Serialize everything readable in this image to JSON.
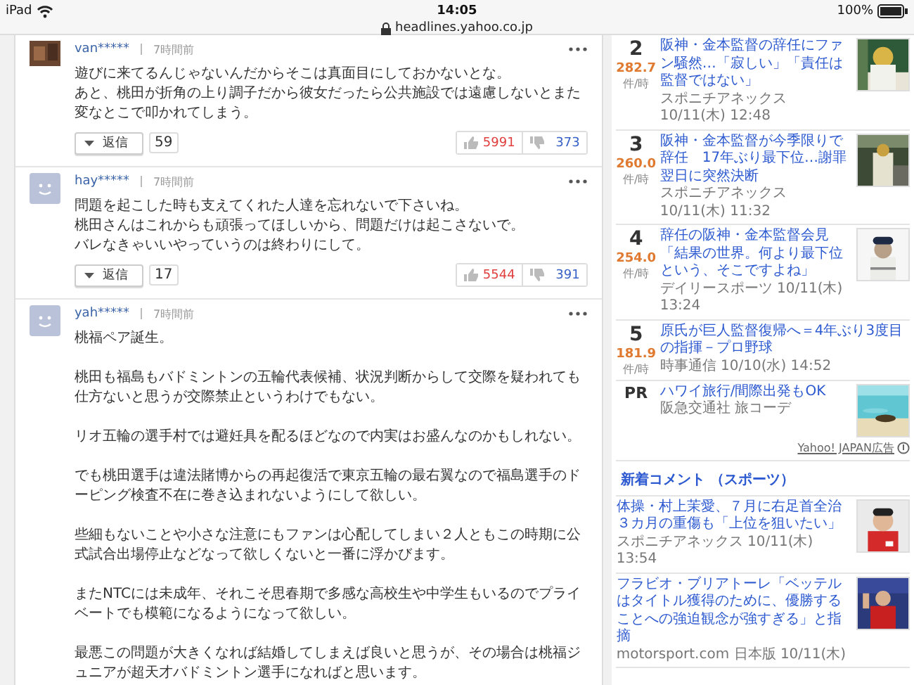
{
  "status_bar": {
    "device": "iPad",
    "time": "14:05",
    "url": "headlines.yahoo.co.jp",
    "battery": "100%"
  },
  "comments": [
    {
      "user": "van*****",
      "posted": "7時間前",
      "paragraphs": [
        [
          "遊びに来てるんじゃないんだからそこは真面目にしておかないとな。",
          "あと、桃田が折角の上り調子だから彼女だったら公共施設では遠慮しないとまた変なとこで叩かれてしまう。"
        ]
      ],
      "reply_label": "返信",
      "reply_count": "59",
      "likes": "5991",
      "dislikes": "373"
    },
    {
      "kind": "default",
      "user": "hay*****",
      "posted": "7時間前",
      "paragraphs": [
        [
          "問題を起こした時も支えてくれた人達を忘れないで下さいね。",
          "桃田さんはこれからも頑張ってほしいから、問題だけは起こさないで。",
          "バレなきゃいいやっていうのは終わりにして。"
        ]
      ],
      "reply_label": "返信",
      "reply_count": "17",
      "likes": "5544",
      "dislikes": "391"
    },
    {
      "kind": "default",
      "user": "yah*****",
      "posted": "7時間前",
      "paragraphs": [
        [
          "桃福ペア誕生。"
        ],
        [
          "桃田も福島もバドミントンの五輪代表候補、状況判断からして交際を疑われても仕方ないと思うが交際禁止というわけでもない。"
        ],
        [
          "リオ五輪の選手村では避妊具を配るほどなので内実はお盛んなのかもしれない。"
        ],
        [
          "でも桃田選手は違法賭博からの再起復活で東京五輪の最右翼なので福島選手のドーピング検査不在に巻き込まれないようにして欲しい。"
        ],
        [
          "些細もないことや小さな注意にもファンは心配してしまい２人ともこの時期に公式試合出場停止などなって欲しくないと一番に浮かびます。"
        ],
        [
          "またNTCには未成年、それこそ思春期で多感な高校生や中学生もいるのでプライベートでも模範になるようになって欲しい。"
        ],
        [
          "最悪この問題が大きくなれば結婚してしまえば良いと思うが、その場合は桃福ジュニアが超天才バドミントン選手になればと思います。"
        ]
      ]
    }
  ],
  "ranking": [
    {
      "rank": "2",
      "score": "282.7",
      "unit": "件/時",
      "title": "阪神・金本監督の辞任にファン騒然…「寂しい」「責任は監督ではない」",
      "meta": "スポニチアネックス 10/11(木) 12:48",
      "thumbnail": true
    },
    {
      "rank": "3",
      "score": "260.0",
      "unit": "件/時",
      "title": "阪神・金本監督が今季限りで辞任　17年ぶり最下位…謝罪翌日に突然決断",
      "meta": "スポニチアネックス 10/11(木) 11:32",
      "thumbnail": true
    },
    {
      "rank": "4",
      "score": "254.0",
      "unit": "件/時",
      "title": "辞任の阪神・金本監督会見「結果の世界。何より最下位という、そこですよね」",
      "meta": "デイリースポーツ 10/11(木) 13:24",
      "thumbnail": true
    },
    {
      "rank": "5",
      "score": "181.9",
      "unit": "件/時",
      "title": "原氏が巨人監督復帰へ＝4年ぶり3度目の指揮－プロ野球",
      "meta": "時事通信 10/10(水) 14:52",
      "thumbnail": false
    }
  ],
  "pr": {
    "label": "PR",
    "title": "ハワイ旅行/間際出発もOK",
    "sponsor": "阪急交通社 旅コーデ",
    "ad_label": "Yahoo! JAPAN広告"
  },
  "new_comments": {
    "heading": "新着コメント （スポーツ）",
    "items": [
      {
        "title": "体操・村上茉愛、７月に右足首全治３カ月の重傷も「上位を狙いたい」",
        "meta": "スポニチアネックス 10/11(木) 13:54"
      },
      {
        "title": "フラビオ・ブリアトーレ「ベッテルはタイトル獲得のために、優勝することへの強迫観念が強すぎる」と指摘",
        "meta": "motorsport.com 日本版 10/11(木)"
      }
    ]
  }
}
